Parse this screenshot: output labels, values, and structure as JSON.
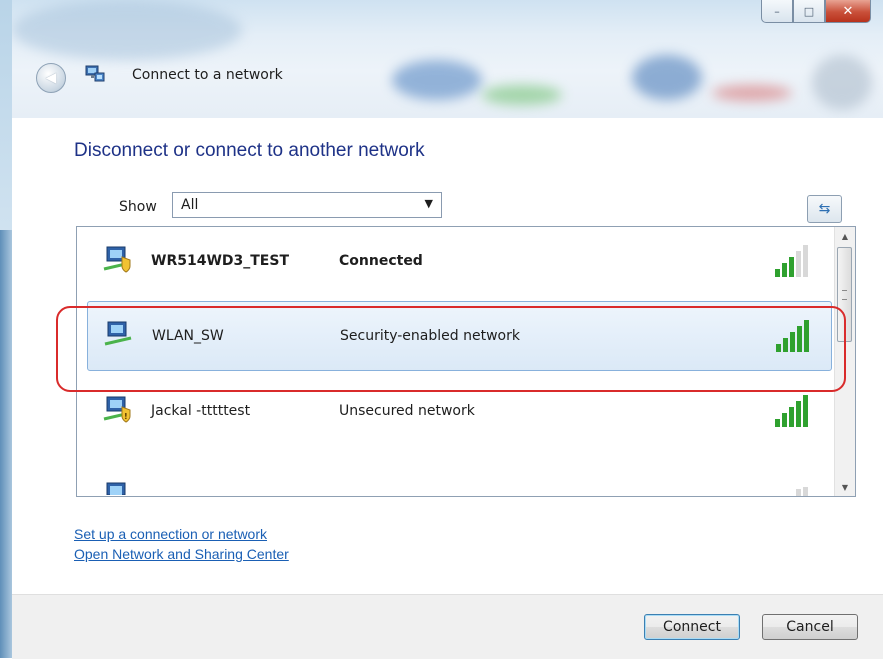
{
  "window": {
    "title": "Connect to a network",
    "controls": {
      "minimize": "–",
      "maximize": "□",
      "close": "✕"
    }
  },
  "main": {
    "heading": "Disconnect or connect to another network",
    "show_label": "Show",
    "show_value": "All",
    "networks": [
      {
        "name": "WR514WD3_TEST",
        "status": "Connected",
        "bold": true,
        "icon": "secured-network-icon",
        "signal_bars": 3
      },
      {
        "name": "WLAN_SW",
        "status": "Security-enabled network",
        "bold": false,
        "icon": "network-icon",
        "signal_bars": 5,
        "selected": true
      },
      {
        "name": "Jackal -tttttest",
        "status": "Unsecured network",
        "bold": false,
        "icon": "unsecured-network-icon",
        "signal_bars": 5
      }
    ],
    "links": {
      "setup": "Set up a connection or network",
      "sharing_center": "Open Network and Sharing Center"
    }
  },
  "buttons": {
    "connect": "Connect",
    "cancel": "Cancel"
  },
  "colors": {
    "heading": "#1e3287",
    "link": "#1a5fb4",
    "highlight": "#d92b2b",
    "signal_on": "#2fa12f"
  }
}
